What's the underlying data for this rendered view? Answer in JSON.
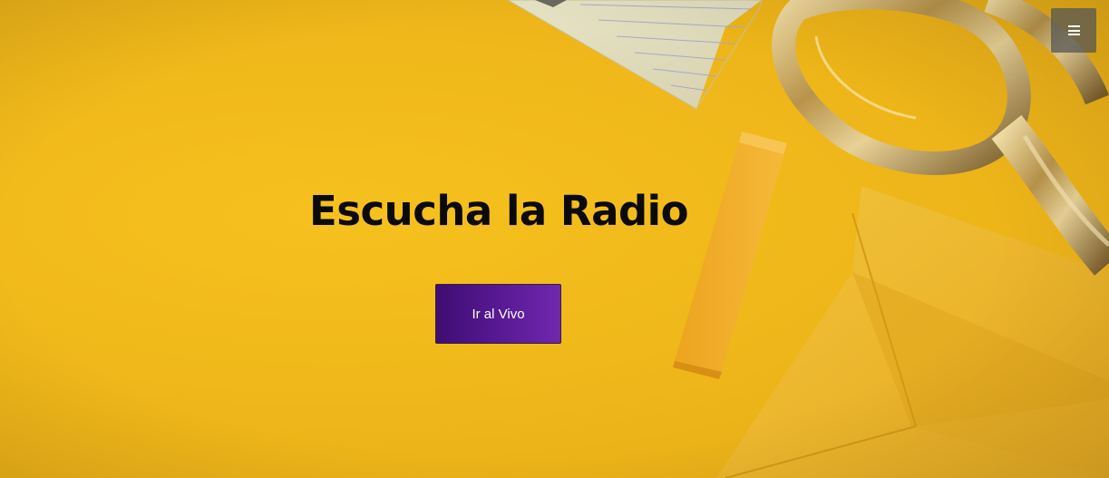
{
  "hero": {
    "title": "Escucha la Radio",
    "cta_label": "Ir al Vivo",
    "background_color": "#f2bb1c",
    "cta_color": "#5a1a95"
  },
  "nav": {
    "menu_icon": "hamburger-menu-icon"
  }
}
